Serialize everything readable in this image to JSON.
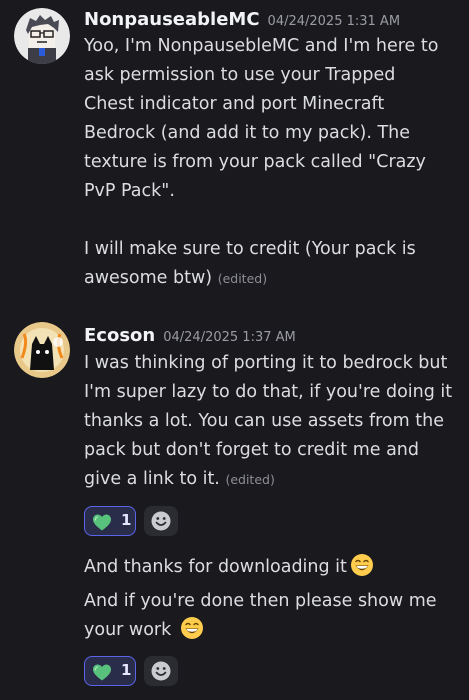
{
  "messages": [
    {
      "username": "NonpauseableMC",
      "timestamp": "04/24/2025 1:31 AM",
      "lines": [
        "Yoo, I'm NonpausebleMC and I'm here to",
        "ask permission to use your Trapped",
        "Chest indicator and port Minecraft",
        "Bedrock (and add it to my pack). The",
        "texture is from your pack called \"Crazy",
        "PvP Pack\".",
        "I will make sure to credit (Your pack is",
        "awesome btw)"
      ],
      "edited": "(edited)"
    },
    {
      "username": "Ecoson",
      "timestamp": "04/24/2025 1:37 AM",
      "lines": [
        "I was thinking of porting it to bedrock but",
        "I'm super lazy to do that, if you're doing it",
        "thanks a lot. You can use assets from the",
        "pack but don't forget to credit me and",
        "give a link to it."
      ],
      "edited": "(edited)",
      "reaction": {
        "emoji": "green-heart-icon",
        "count": "1"
      }
    },
    {
      "lines": [
        "And thanks for downloading it",
        "And if you're done then please show me",
        "your work"
      ],
      "reaction": {
        "emoji": "green-heart-icon",
        "count": "1"
      }
    }
  ],
  "colors": {
    "background": "#1a1a1e",
    "username": "#f2f3f5",
    "reaction_border": "#5a65ea",
    "heart": "#58c27d"
  }
}
